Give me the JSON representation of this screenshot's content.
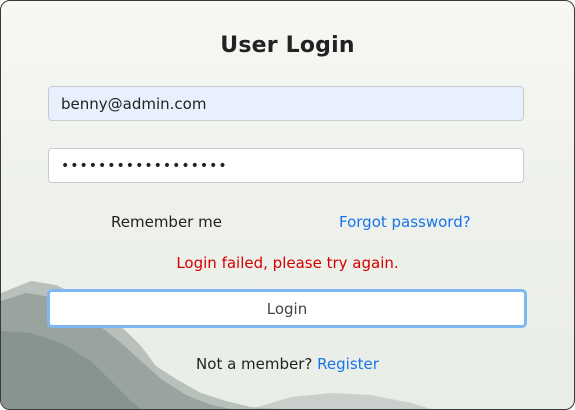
{
  "form": {
    "title": "User Login",
    "email_value": "benny@admin.com",
    "password_value": "••••••••••••••••••",
    "remember_label": "Remember me",
    "forgot_label": "Forgot password?",
    "error_message": "Login failed, please try again.",
    "login_button_label": "Login",
    "signup_prompt": "Not a member?",
    "register_link_label": "Register"
  },
  "colors": {
    "link": "#1a73e8",
    "error": "#d40000",
    "email_autofill_bg": "#e8f0fe",
    "button_focus_border": "#7db7f2"
  }
}
